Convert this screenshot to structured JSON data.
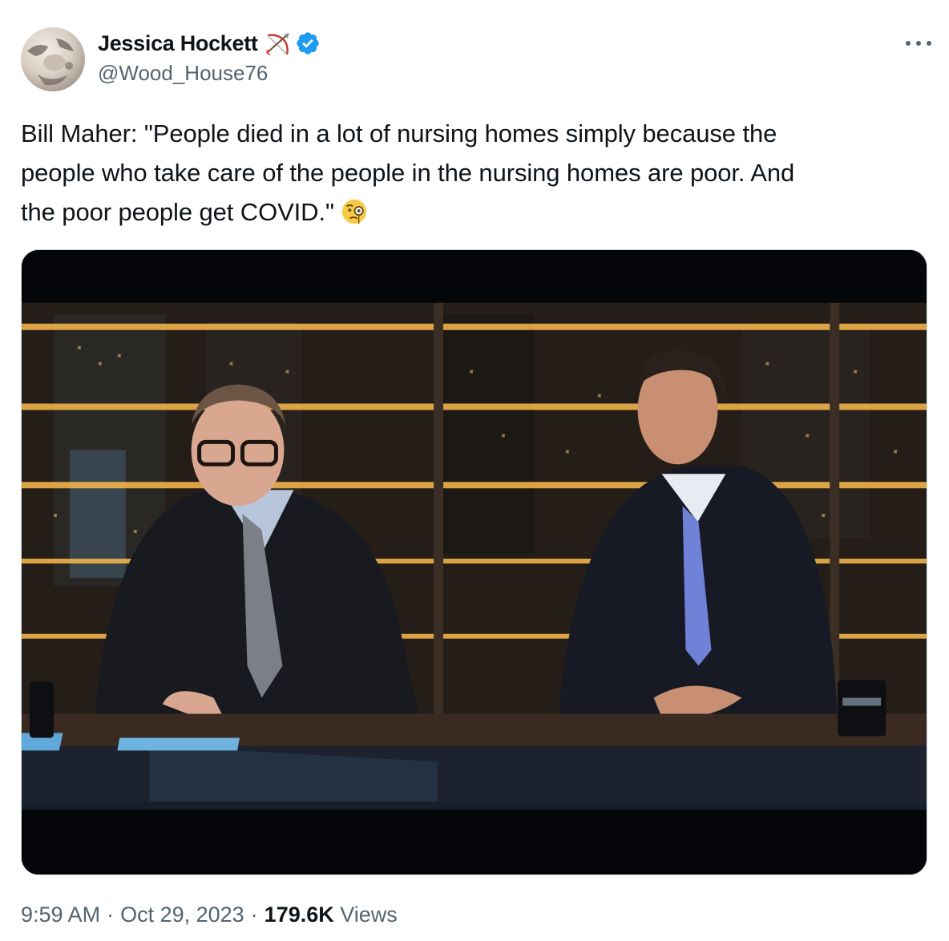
{
  "author": {
    "display_name": "Jessica Hockett",
    "handle": "@Wood_House76",
    "badges": [
      "bow-and-arrow-icon",
      "verified-badge-icon"
    ],
    "avatar": "avatar-icon"
  },
  "tweet": {
    "lines": [
      "Bill Maher: \"People died in a lot of nursing homes simply because the",
      "people who take care of the people in the nursing homes are poor. And",
      "the poor people get COVID.\""
    ],
    "emoji": "face-with-monocle-icon"
  },
  "media": {
    "type": "video",
    "description_icon": "video-thumbnail"
  },
  "meta": {
    "time": "9:59 AM",
    "separator": "·",
    "date": "Oct 29, 2023",
    "views_count": "179.6K",
    "views_label": "Views"
  },
  "colors": {
    "text": "#0f1419",
    "secondary": "#536471",
    "verified": "#1d9bf0"
  }
}
